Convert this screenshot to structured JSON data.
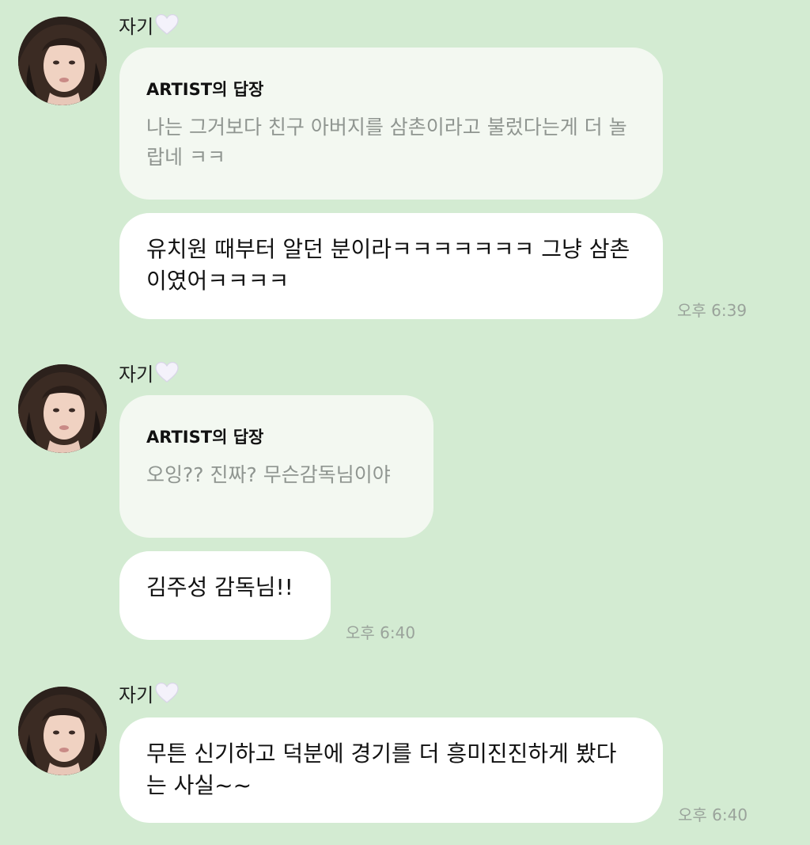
{
  "messages": [
    {
      "sender": "자기",
      "reply": {
        "title": "ARTIST의 답장",
        "text": "나는 그거보다 친구 아버지를 삼촌이라고 불렀다는게 더 놀랍네 ㅋㅋ"
      },
      "text": "유치원 때부터 알던 분이라ㅋㅋㅋㅋㅋㅋㅋ 그냥 삼촌이였어ㅋㅋㅋㅋ",
      "time": "오후 6:39"
    },
    {
      "sender": "자기",
      "reply": {
        "title": "ARTIST의 답장",
        "text": "오잉?? 진짜? 무슨감독님이야"
      },
      "text": "김주성 감독님!!",
      "time": "오후 6:40"
    },
    {
      "sender": "자기",
      "text": "무튼 신기하고 덕분에 경기를 더 흥미진진하게 봤다는 사실~~",
      "time": "오후 6:40"
    }
  ],
  "icons": {
    "heart": "white-heart-icon",
    "heart_color": "#f4f2fb"
  },
  "colors": {
    "background": "#d3ebd2",
    "reply_bubble": "#f3f8f1",
    "message_bubble": "#ffffff",
    "reply_text": "#8f9590",
    "time_text": "#9aa39b"
  }
}
